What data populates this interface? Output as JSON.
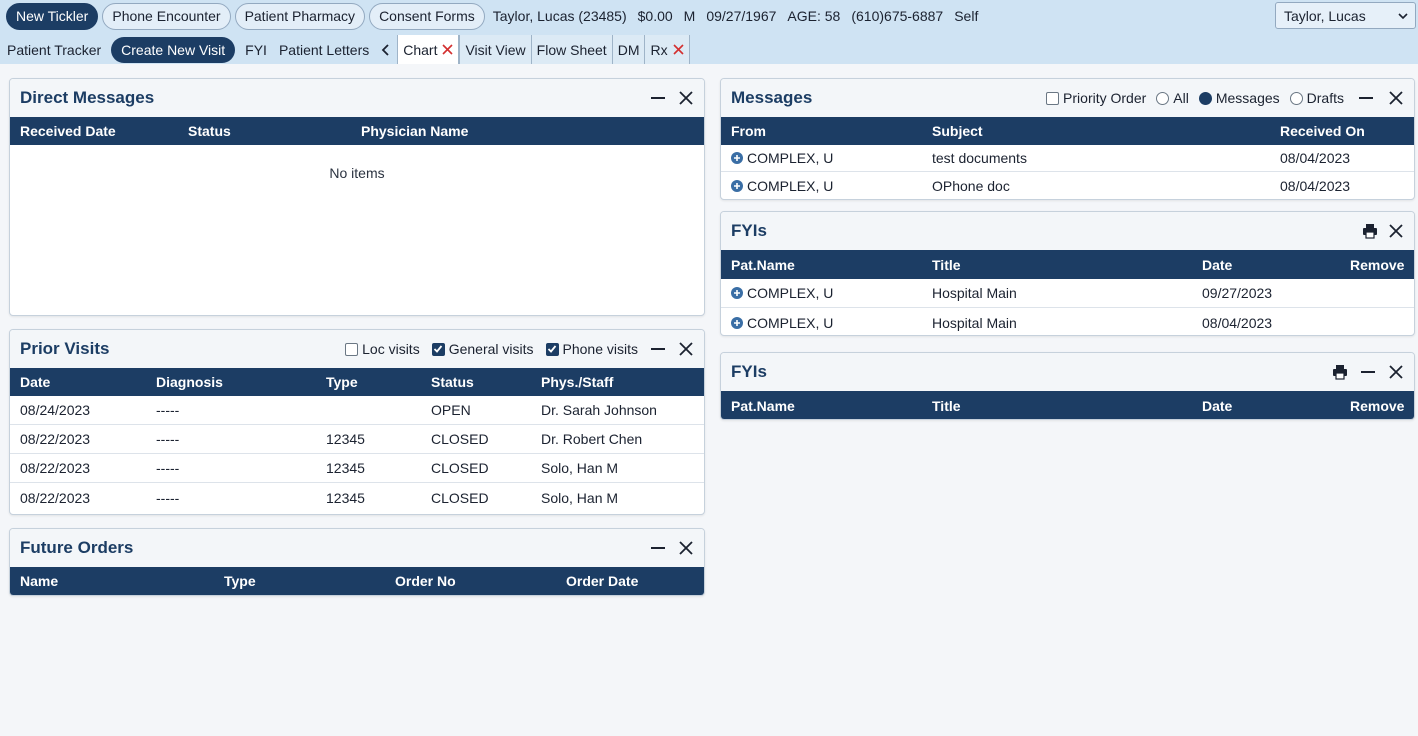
{
  "toolbar": {
    "new_tickler": "New Tickler",
    "phone_encounter": "Phone Encounter",
    "patient_pharmacy": "Patient Pharmacy",
    "consent_forms": "Consent Forms"
  },
  "patient": {
    "name_id": "Taylor, Lucas (23485)",
    "balance": "$0.00",
    "sex": "M",
    "dob": "09/27/1967",
    "age": "AGE: 58",
    "phone": "(610)675-6887",
    "relation": "Self",
    "selector_value": "Taylor, Lucas"
  },
  "nav": {
    "patient_tracker": "Patient Tracker",
    "create_new_visit": "Create New Visit",
    "fyi": "FYI",
    "patient_letters": "Patient Letters",
    "tabs": [
      {
        "label": "Chart"
      },
      {
        "label": "Visit View"
      },
      {
        "label": "Flow Sheet"
      },
      {
        "label": "DM"
      },
      {
        "label": "Rx"
      }
    ]
  },
  "icons": {
    "minimize": "minus-icon",
    "close": "close-icon",
    "print": "printer-icon",
    "expand": "plus-circle-icon",
    "prev_tab": "chevron-left-icon",
    "dropdown": "chevron-down-icon"
  },
  "colors": {
    "header_navy": "#1c3d64",
    "toolbar_bg": "#cfe3f3",
    "close_red": "#d32f2f"
  },
  "direct_messages": {
    "title": "Direct Messages",
    "columns": [
      "Received Date",
      "Status",
      "Physician Name"
    ],
    "empty_text": "No items"
  },
  "prior_visits": {
    "title": "Prior Visits",
    "filters": {
      "loc_visits": "Loc visits",
      "general_visits": "General visits",
      "phone_visits": "Phone visits"
    },
    "filter_states": {
      "loc_visits": false,
      "general_visits": true,
      "phone_visits": true
    },
    "columns": [
      "Date",
      "Diagnosis",
      "Type",
      "Status",
      "Phys./Staff"
    ],
    "rows": [
      [
        "08/24/2023",
        "-----",
        "",
        "OPEN",
        "Dr. Sarah Johnson"
      ],
      [
        "08/22/2023",
        "-----",
        "12345",
        "CLOSED",
        "Dr. Robert Chen"
      ],
      [
        "08/22/2023",
        "-----",
        "12345",
        "CLOSED",
        "Solo, Han M"
      ],
      [
        "08/22/2023",
        "-----",
        "12345",
        "CLOSED",
        "Solo, Han M"
      ]
    ]
  },
  "future_orders": {
    "title": "Future Orders",
    "columns": [
      "Name",
      "Type",
      "Order No",
      "Order Date"
    ]
  },
  "messages": {
    "title": "Messages",
    "priority_order": "Priority Order",
    "filter_all": "All",
    "filter_messages": "Messages",
    "filter_drafts": "Drafts",
    "selected_filter": "Messages",
    "columns": [
      "From",
      "Subject",
      "Received On"
    ],
    "rows": [
      [
        "COMPLEX, U",
        "test documents",
        "08/04/2023"
      ],
      [
        "COMPLEX, U",
        "OPhone doc",
        "08/04/2023"
      ]
    ]
  },
  "fyis_1": {
    "title": "FYIs",
    "columns": [
      "Pat.Name",
      "Title",
      "Date",
      "Remove"
    ],
    "rows": [
      [
        "COMPLEX, U",
        "Hospital Main",
        "09/27/2023"
      ],
      [
        "COMPLEX, U",
        "Hospital Main",
        "08/04/2023"
      ]
    ]
  },
  "fyis_2": {
    "title": "FYIs",
    "columns": [
      "Pat.Name",
      "Title",
      "Date",
      "Remove"
    ]
  }
}
